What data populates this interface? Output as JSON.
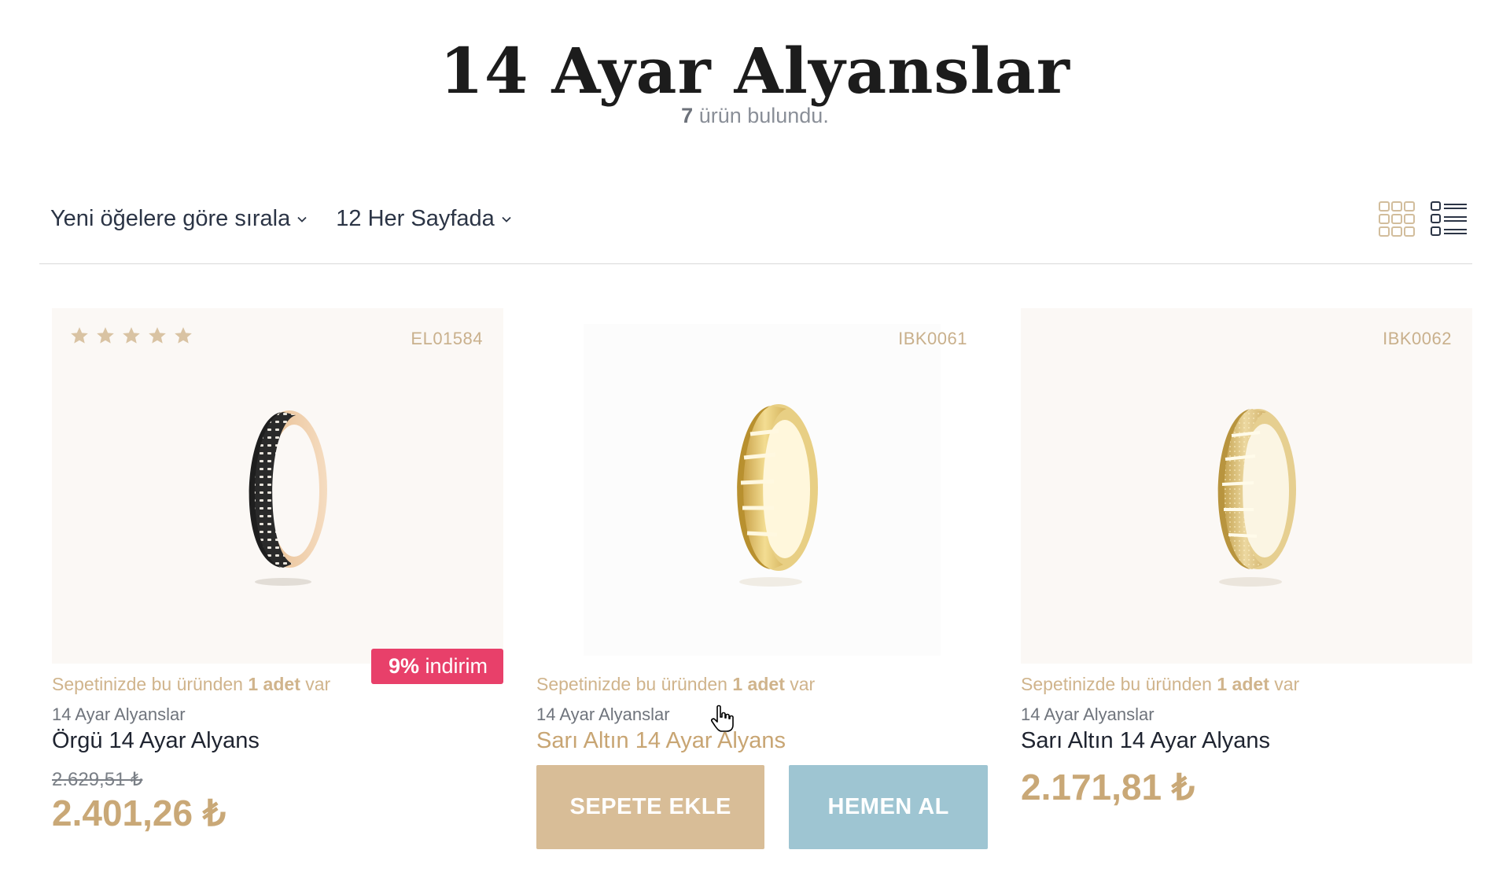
{
  "page": {
    "title": "14 Ayar Alyanslar",
    "count_number": "7",
    "count_text": " ürün bulundu."
  },
  "toolbar": {
    "sort_label": "Yeni öğelere göre sırala",
    "per_page_label": "12 Her Sayfada"
  },
  "products": [
    {
      "sku": "EL01584",
      "rating_stars": 5,
      "cart_note_prefix": "Sepetinizde bu üründen ",
      "cart_note_qty": "1 adet",
      "cart_note_suffix": " var",
      "category": "14 Ayar Alyanslar",
      "name": "Örgü 14 Ayar Alyans",
      "old_price": "2.629,51 ₺",
      "price": "2.401,26 ₺",
      "discount_value": "9%",
      "discount_text": " indirim"
    },
    {
      "sku": "IBK0061",
      "cart_note_prefix": "Sepetinizde bu üründen ",
      "cart_note_qty": "1 adet",
      "cart_note_suffix": " var",
      "category": "14 Ayar Alyanslar",
      "name": "Sarı Altın 14 Ayar Alyans",
      "add_to_cart": "SEPETE EKLE",
      "buy_now": "HEMEN AL"
    },
    {
      "sku": "IBK0062",
      "cart_note_prefix": "Sepetinizde bu üründen ",
      "cart_note_qty": "1 adet",
      "cart_note_suffix": " var",
      "category": "14 Ayar Alyanslar",
      "name": "Sarı Altın 14 Ayar Alyans",
      "price": "2.171,81 ₺"
    }
  ],
  "colors": {
    "accent_gold": "#c9a877",
    "discount_badge": "#e8406a",
    "add_to_cart_button": "#d8bd97",
    "buy_now_button": "#9ec5d2"
  },
  "icons": [
    "chevron-down-icon",
    "grid-view-icon",
    "list-view-icon",
    "star-icon",
    "hand-cursor-icon"
  ]
}
